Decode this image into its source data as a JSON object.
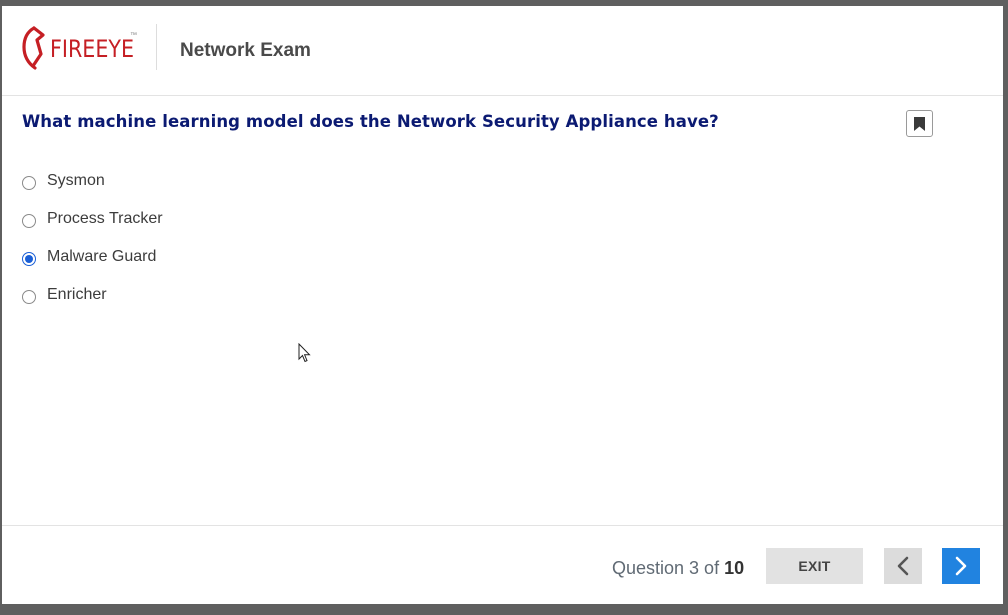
{
  "brand": {
    "logo_text": "FIREEYE",
    "trademark": "™",
    "color": "#c51f24"
  },
  "header": {
    "title": "Network Exam"
  },
  "question": {
    "text": "What machine learning model does the Network Security Appliance have?",
    "bookmark_icon": "bookmark-icon",
    "options": [
      {
        "label": "Sysmon",
        "selected": false
      },
      {
        "label": "Process Tracker",
        "selected": false
      },
      {
        "label": "Malware Guard",
        "selected": true
      },
      {
        "label": "Enricher",
        "selected": false
      }
    ]
  },
  "footer": {
    "progress_prefix": "Question 3 of ",
    "progress_total": "10",
    "exit_label": "EXIT",
    "prev_icon": "chevron-left-icon",
    "next_icon": "chevron-right-icon",
    "accent": "#2183e0"
  }
}
